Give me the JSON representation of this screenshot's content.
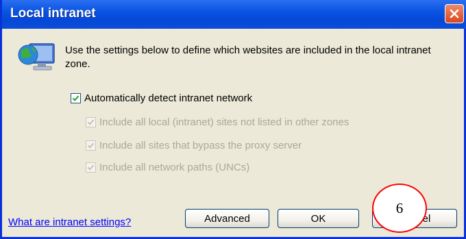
{
  "window": {
    "title": "Local intranet"
  },
  "description": "Use the settings below to define which websites are included in the local intranet zone.",
  "checkboxes": {
    "auto_detect": {
      "label": "Automatically detect intranet network",
      "checked": true,
      "enabled": true
    },
    "include_local_sites": {
      "label": "Include all local (intranet) sites not listed in other zones",
      "checked": true,
      "enabled": false
    },
    "include_bypass_proxy": {
      "label": "Include all sites that bypass the proxy server",
      "checked": true,
      "enabled": false
    },
    "include_network_paths": {
      "label": "Include all network paths (UNCs)",
      "checked": true,
      "enabled": false
    }
  },
  "footer": {
    "help_link": "What are intranet settings?",
    "advanced_label": "Advanced",
    "ok_label": "OK",
    "cancel_label": "Cancel"
  },
  "annotation": {
    "number": "6",
    "color": "#ff0000"
  },
  "icons": {
    "zone": "intranet-globe-monitor-icon",
    "close": "close-icon",
    "check": "checkmark-icon"
  }
}
